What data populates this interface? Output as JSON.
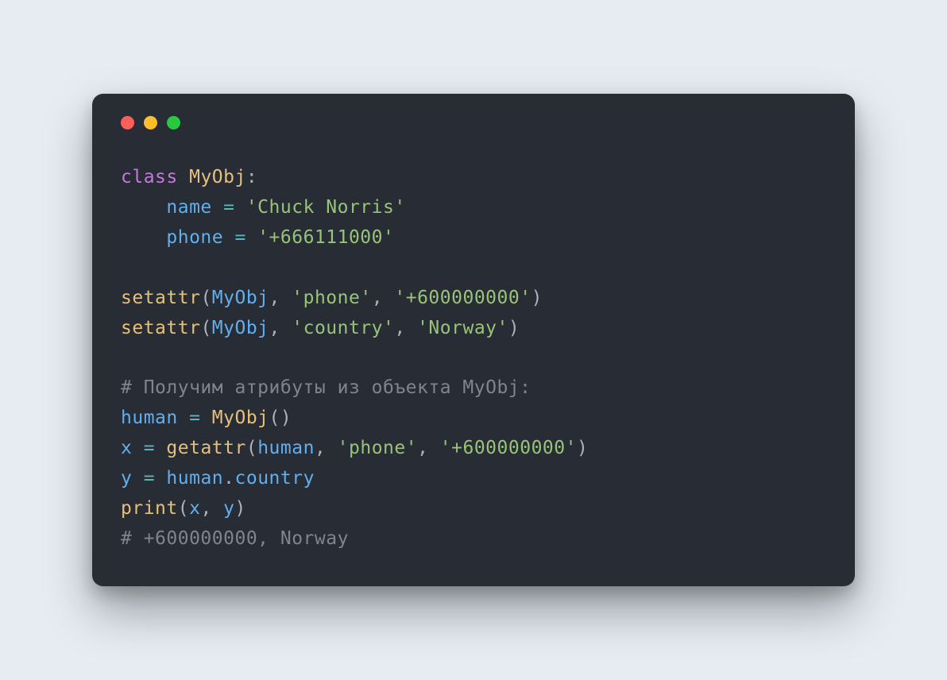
{
  "code": {
    "l1": {
      "class_kw": "class",
      "name": "MyObj",
      "colon": ":"
    },
    "l2": {
      "indent": "    ",
      "attr": "name",
      "eq": " = ",
      "val": "'Chuck Norris'"
    },
    "l3": {
      "indent": "    ",
      "attr": "phone",
      "eq": " = ",
      "val": "'+666111000'"
    },
    "l5": {
      "func": "setattr",
      "open": "(",
      "arg1": "MyObj",
      "c1": ", ",
      "arg2": "'phone'",
      "c2": ", ",
      "arg3": "'+600000000'",
      "close": ")"
    },
    "l6": {
      "func": "setattr",
      "open": "(",
      "arg1": "MyObj",
      "c1": ", ",
      "arg2": "'country'",
      "c2": ", ",
      "arg3": "'Norway'",
      "close": ")"
    },
    "l8": {
      "comment": "# Получим атрибуты из объекта MyObj:"
    },
    "l9": {
      "var": "human",
      "eq": " = ",
      "cls": "MyObj",
      "parens": "()"
    },
    "l10": {
      "var": "x",
      "eq": " = ",
      "func": "getattr",
      "open": "(",
      "arg1": "human",
      "c1": ", ",
      "arg2": "'phone'",
      "c2": ", ",
      "arg3": "'+600000000'",
      "close": ")"
    },
    "l11": {
      "var": "y",
      "eq": " = ",
      "obj": "human",
      "dot": ".",
      "prop": "country"
    },
    "l12": {
      "func": "print",
      "open": "(",
      "arg1": "x",
      "c1": ", ",
      "arg2": "y",
      "close": ")"
    },
    "l13": {
      "comment": "# +600000000, Norway"
    }
  }
}
